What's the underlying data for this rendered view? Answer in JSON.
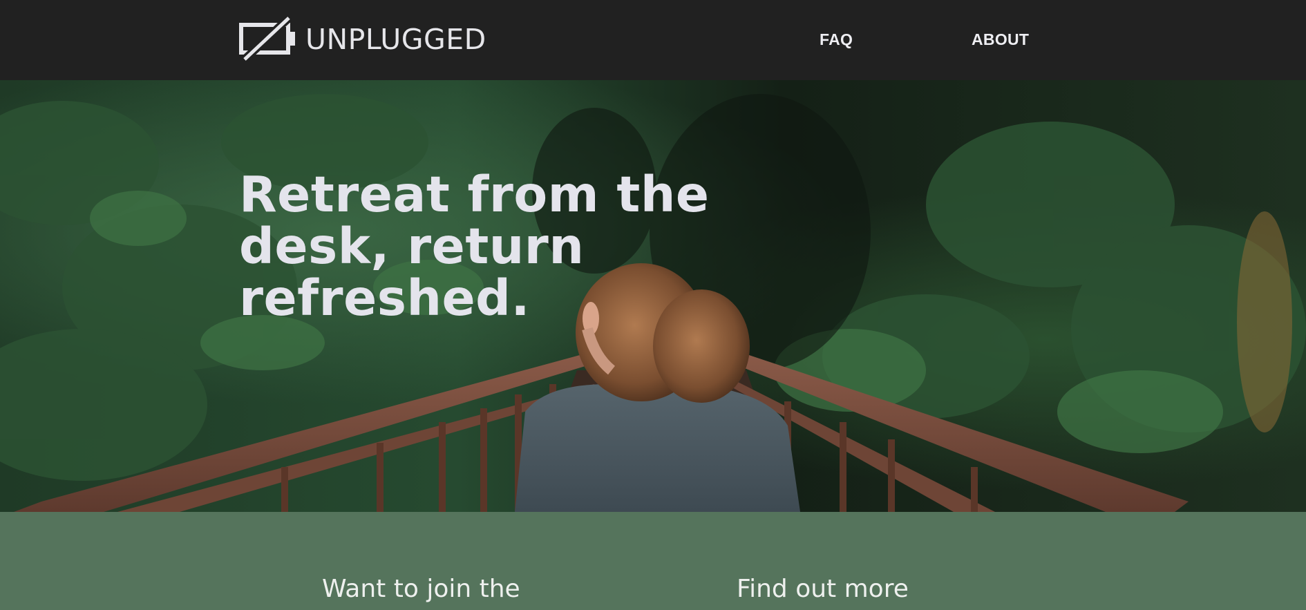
{
  "header": {
    "logo_text": "UNPLUGGED",
    "logo_icon": "unplugged-battery-icon",
    "nav": [
      {
        "label": "FAQ"
      },
      {
        "label": "ABOUT"
      }
    ]
  },
  "hero": {
    "title": "Retreat from the desk, return refreshed.",
    "image": "woman-on-forest-bridge"
  },
  "band": {
    "headings": [
      {
        "label": "Want to join the"
      },
      {
        "label": "Find out more"
      }
    ]
  },
  "colors": {
    "header_bg": "#212121",
    "band_bg": "#55745c",
    "text_light": "#e4e4ec"
  }
}
